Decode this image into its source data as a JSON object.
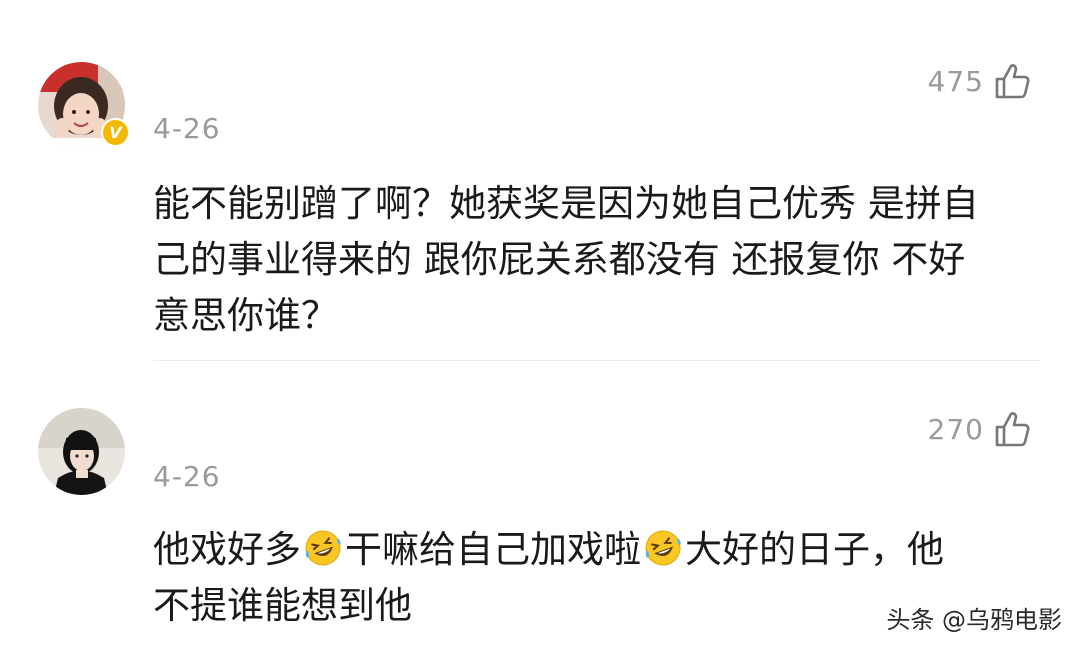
{
  "comments": [
    {
      "date": "4-26",
      "like_count": "475",
      "verified": true,
      "lines": [
        "能不能别蹭了啊？她获奖是因为她自己优秀 是拼自",
        "己的事业得来的 跟你屁关系都没有 还报复你 不好",
        "意思你谁？"
      ]
    },
    {
      "date": "4-26",
      "like_count": "270",
      "verified": false,
      "segments": [
        "他戏好多",
        "干嘛给自己加戏啦",
        "大好的日子，他",
        "不提谁能想到他"
      ]
    }
  ],
  "icons": {
    "like": "thumbs-up-outline-icon",
    "laugh": "rolling-on-floor-laughing-emoji",
    "verified": "verified-v-badge"
  },
  "badge_letter": "V",
  "watermark": "头条 @乌鸦电影",
  "colors": {
    "meta_gray": "#9a9a9a",
    "text": "#1a1a1a",
    "badge": "#f5b800",
    "divider": "#ececec"
  }
}
